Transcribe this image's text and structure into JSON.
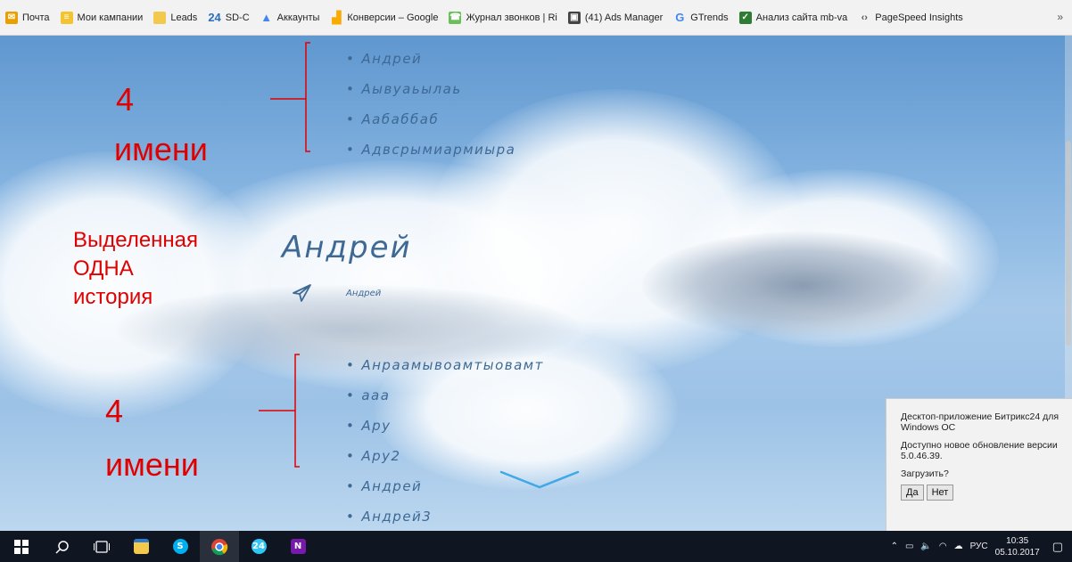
{
  "bookmarks": [
    {
      "label": "Почта",
      "icon": "mail-icon",
      "color": "#e8a000"
    },
    {
      "label": "Мои кампании",
      "icon": "campaign-icon",
      "color": "#f4c430"
    },
    {
      "label": "Leads",
      "icon": "folder-icon",
      "color": "#f2c94c"
    },
    {
      "label": "SD-C",
      "icon": "bitrix24-icon",
      "color": "#2a6ebd",
      "badge": "24"
    },
    {
      "label": "Аккаунты",
      "icon": "google-ads-icon",
      "color": "#4285f4"
    },
    {
      "label": "Конверсии – Google",
      "icon": "analytics-icon",
      "color": "#f9ab00"
    },
    {
      "label": "Журнал звонков | Ri",
      "icon": "calltracking-icon",
      "color": "#6bbf59"
    },
    {
      "label": "(41) Ads Manager",
      "icon": "ads-manager-icon",
      "color": "#444"
    },
    {
      "label": "GTrends",
      "icon": "google-icon",
      "color": "#4285f4"
    },
    {
      "label": "Анализ сайта mb-va",
      "icon": "check-icon",
      "color": "#2e7d32"
    },
    {
      "label": "PageSpeed Insights",
      "icon": "pagespeed-icon",
      "color": "#555"
    }
  ],
  "bookmarks_more": "»",
  "names_top": [
    "Андрей",
    "Аывуаьылаь",
    "Аабаббаб",
    "Адвсрымиармиыра"
  ],
  "story": {
    "title": "Андрей",
    "subtitle": "Андрей"
  },
  "names_bottom": [
    "Анраамывоамтыовамт",
    "ааа",
    "Ару",
    "Ару2",
    "Андрей",
    "Андрей3"
  ],
  "annotations": {
    "top_count": "4",
    "top_word": "имени",
    "middle_line1": "Выделенная",
    "middle_line2": "ОДНА",
    "middle_line3": "история",
    "bottom_count": "4",
    "bottom_word": "имени",
    "color": "#e00000"
  },
  "popup": {
    "title": "Десктоп-приложение Битрикс24 для Windows OC",
    "message": "Доступно новое обновление версии 5.0.46.39.",
    "question": "Загрузить?",
    "yes": "Да",
    "no": "Нет"
  },
  "taskbar": {
    "language": "РУС",
    "time": "10:35",
    "date": "05.10.2017",
    "apps": [
      "windows-start-icon",
      "search-icon",
      "task-view-icon",
      "file-explorer-icon",
      "skype-icon",
      "chrome-icon",
      "bitrix24-app-icon",
      "onenote-icon"
    ]
  },
  "colors": {
    "accent_text": "#3e6995",
    "taskbar": "#101522"
  }
}
